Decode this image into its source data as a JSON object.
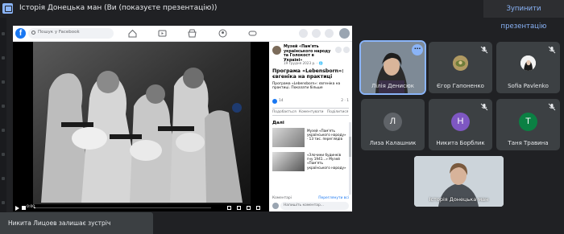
{
  "presentation": {
    "title": "Історія Донецька ман (Ви (показуєте презентацію))",
    "stop_label": "Зупинити презентацію"
  },
  "facebook": {
    "logo_letter": "f",
    "search_placeholder": "Пошук у Facebook",
    "nav_icons": [
      "home-icon",
      "video-icon",
      "marketplace-icon",
      "groups-icon",
      "gaming-icon"
    ],
    "page_name": "Музей «Пам'ять українського народу та Голокост в Україні»",
    "post_date": "19 грудня 2023 р. · 🌐",
    "post_title": "Програма «Lebensborn»: євгеніка на практиці",
    "post_text": "Програма «Lebensborn»: євгеніка на практиці. Показати більше",
    "reactions_count": "14",
    "reactions_right": "2 · 1",
    "actions": [
      "Подобається",
      "Коментувати",
      "Поділитися"
    ],
    "related_heading": "Далі",
    "related": [
      {
        "text": "Музей «Пам'ять українського народу» · 13 тис. переглядів"
      },
      {
        "text": "«Злочини будинків гну 1941...» Музей «Пам'ять українського народу»"
      }
    ],
    "comments_label": "Коментарі",
    "comments_link": "Переглянути всі",
    "comment_placeholder": "Напишіть коментар...",
    "video_time": "0:00"
  },
  "participants": [
    {
      "name": "Лілія Денисюк",
      "kind": "photo",
      "active": true
    },
    {
      "name": "Єгор Гапоненко",
      "kind": "photo",
      "active": false
    },
    {
      "name": "Sofia Pavlenko",
      "kind": "photo",
      "active": false
    },
    {
      "name": "Лиза Калашник",
      "kind": "letter",
      "letter": "Л",
      "color": "#5f6368"
    },
    {
      "name": "Никита Борблик",
      "kind": "letter",
      "letter": "Н",
      "color": "#7e57c2"
    },
    {
      "name": "Таня Травина",
      "kind": "letter",
      "letter": "Т",
      "color": "#0b8043"
    }
  ],
  "self_view": {
    "name": "Історія Донецька ман"
  },
  "toast": {
    "text": "Никита Лицоев залишає зустріч"
  },
  "colors": {
    "accent": "#8ab4f8",
    "background": "#202124",
    "tile": "#3c4043",
    "facebook_blue": "#1877f2"
  }
}
